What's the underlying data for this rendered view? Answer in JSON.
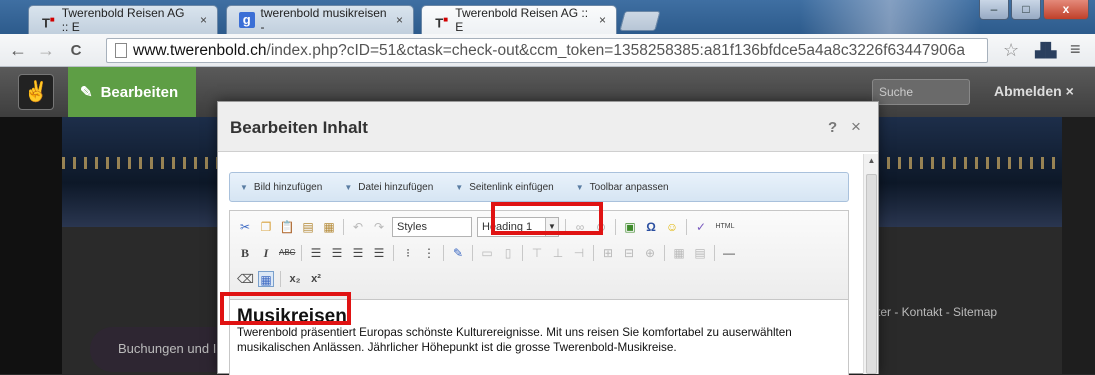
{
  "browser": {
    "tabs": [
      {
        "title": "Twerenbold Reisen AG :: E",
        "favicon": "T-logo",
        "close": "×"
      },
      {
        "title": "twerenbold musikreisen -",
        "favicon": "google-g",
        "close": "×"
      },
      {
        "title": "Twerenbold Reisen AG :: E",
        "favicon": "T-logo",
        "close": "×"
      }
    ],
    "window_buttons": {
      "minimize": "–",
      "maximize": "□",
      "close": "x"
    },
    "nav": {
      "back": "←",
      "forward": "→",
      "reload": "C"
    },
    "url": {
      "host": "www.twerenbold.ch",
      "path": "/index.php?cID=51&ctask=check-out&ccm_token=1358258385:a81f136bfdce5a4a8c3226f63447906a"
    },
    "menu_glyph": "≡",
    "star_glyph": "☆"
  },
  "cms": {
    "logo_glyph": "✌",
    "edit_label": "Bearbeiten",
    "edit_glyph": "✎",
    "search_placeholder": "Suche",
    "logout_label": "Abmelden",
    "logout_glyph": "×"
  },
  "background_page": {
    "left_panel_text": "Buchungen und Ir",
    "right_footer_text": "ter  -  Kontakt  -  Sitemap"
  },
  "dialog": {
    "title": "Bearbeiten Inhalt",
    "help": "?",
    "close": "×",
    "actions": [
      {
        "label": "Bild hinzufügen"
      },
      {
        "label": "Datei hinzufügen"
      },
      {
        "label": "Seitenlink einfügen"
      },
      {
        "label": "Toolbar anpassen"
      }
    ],
    "toolbar": {
      "styles_value": "Styles",
      "format_value": "Heading 1",
      "html_label": "HTML"
    },
    "content": {
      "heading": "Musikreisen",
      "paragraph": "Twerenbold präsentiert Europas schönste Kulturereignisse. Mit uns reisen Sie komfortabel zu auserwählten musikalischen Anlässen. Jährlicher Höhepunkt ist die grosse Twerenbold-Musikreise."
    }
  },
  "colors": {
    "highlight": "#e01313",
    "edit_green": "#5e9e45",
    "chrome_blue": "#2d5b8c"
  }
}
